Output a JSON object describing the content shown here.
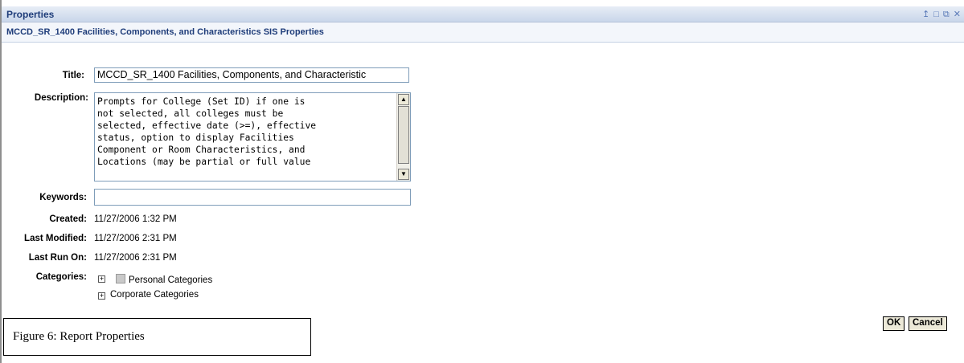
{
  "window": {
    "title": "Properties",
    "controls": [
      "↥",
      "□",
      "⧉",
      "✕"
    ]
  },
  "header": {
    "subtitle": "MCCD_SR_1400 Facilities, Components, and Characteristics SIS Properties"
  },
  "form": {
    "title_label": "Title:",
    "title_value": "MCCD_SR_1400 Facilities, Components, and Characteristic",
    "description_label": "Description:",
    "description_value": "Prompts for College (Set ID) if one is\nnot selected, all colleges must be\nselected, effective date (>=), effective\nstatus, option to display Facilities\nComponent or Room Characteristics, and\nLocations (may be partial or full value",
    "keywords_label": "Keywords:",
    "keywords_value": "",
    "created_label": "Created:",
    "created_value": "11/27/2006 1:32 PM",
    "last_modified_label": "Last Modified:",
    "last_modified_value": "11/27/2006 2:31 PM",
    "last_run_label": "Last Run On:",
    "last_run_value": "11/27/2006 2:31 PM",
    "categories_label": "Categories:",
    "categories": [
      {
        "label": "Personal Categories",
        "checkbox": true,
        "checked": false
      },
      {
        "label": "Corporate Categories",
        "checkbox": false
      }
    ]
  },
  "buttons": {
    "ok": "OK",
    "cancel": "Cancel"
  },
  "caption": "Figure 6:  Report Properties"
}
